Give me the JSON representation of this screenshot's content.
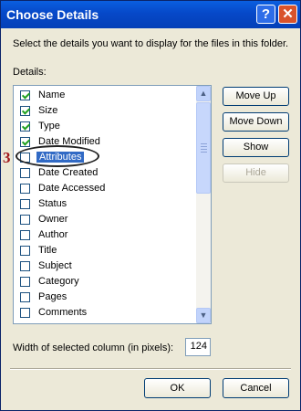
{
  "window": {
    "title": "Choose Details",
    "help_label": "?",
    "close_label": "✕"
  },
  "prompt": "Select the details you want to display for the files in this folder.",
  "details_label": "Details:",
  "items": [
    {
      "label": "Name",
      "checked": true
    },
    {
      "label": "Size",
      "checked": true
    },
    {
      "label": "Type",
      "checked": true
    },
    {
      "label": "Date Modified",
      "checked": true
    },
    {
      "label": "Attributes",
      "checked": false,
      "selected": true
    },
    {
      "label": "Date Created",
      "checked": false
    },
    {
      "label": "Date Accessed",
      "checked": false
    },
    {
      "label": "Status",
      "checked": false
    },
    {
      "label": "Owner",
      "checked": false
    },
    {
      "label": "Author",
      "checked": false
    },
    {
      "label": "Title",
      "checked": false
    },
    {
      "label": "Subject",
      "checked": false
    },
    {
      "label": "Category",
      "checked": false
    },
    {
      "label": "Pages",
      "checked": false
    },
    {
      "label": "Comments",
      "checked": false
    }
  ],
  "buttons": {
    "move_up": "Move Up",
    "move_down": "Move Down",
    "show": "Show",
    "hide": "Hide",
    "ok": "OK",
    "cancel": "Cancel"
  },
  "width": {
    "label": "Width of selected column (in pixels):",
    "value": "124"
  },
  "annotation": {
    "marker": "3"
  },
  "icons": {
    "scroll_up": "chevron-up-icon",
    "scroll_down": "chevron-down-icon"
  }
}
